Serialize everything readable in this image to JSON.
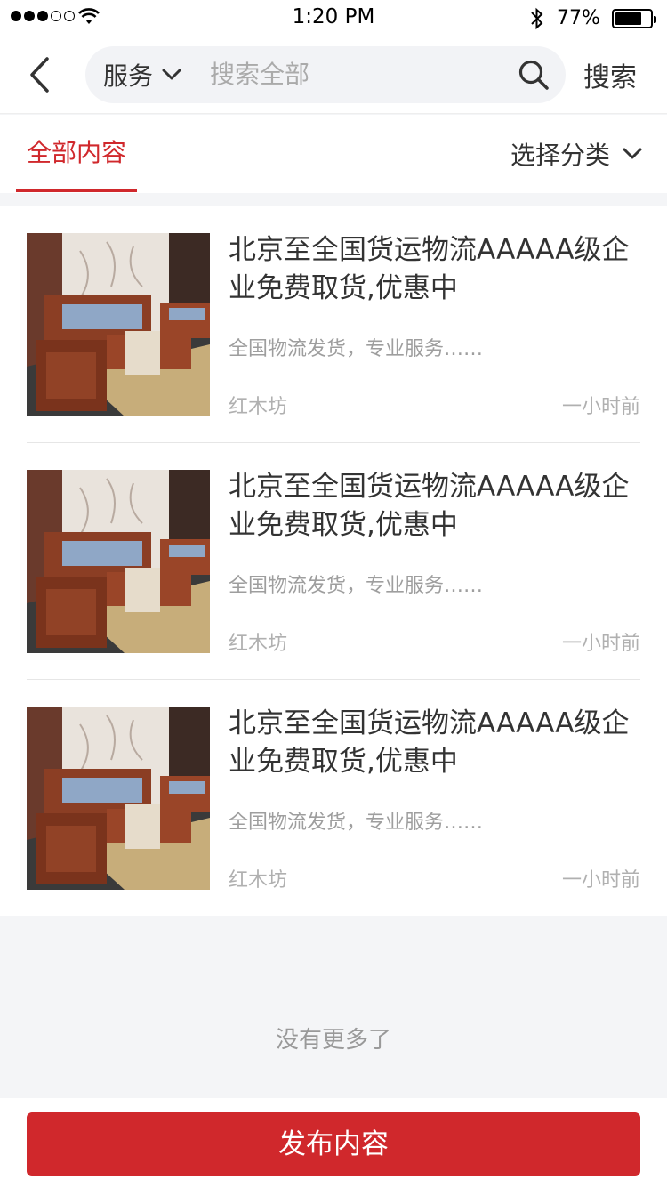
{
  "status_bar": {
    "time": "1:20 PM",
    "battery_percent": "77%",
    "battery_level": 0.77
  },
  "header": {
    "scope_label": "服务",
    "search_placeholder": "搜索全部",
    "search_button": "搜索"
  },
  "tabs": {
    "active_label": "全部内容",
    "category_label": "选择分类"
  },
  "items": [
    {
      "title": "北京至全国货运物流AAAAA级企业免费取货,优惠中",
      "description": "全国物流发货，专业服务……",
      "shop": "红木坊",
      "time": "一小时前"
    },
    {
      "title": "北京至全国货运物流AAAAA级企业免费取货,优惠中",
      "description": "全国物流发货，专业服务……",
      "shop": "红木坊",
      "time": "一小时前"
    },
    {
      "title": "北京至全国货运物流AAAAA级企业免费取货,优惠中",
      "description": "全国物流发货，专业服务……",
      "shop": "红木坊",
      "time": "一小时前"
    }
  ],
  "footer": {
    "no_more_text": "没有更多了",
    "publish_button": "发布内容"
  },
  "colors": {
    "accent": "#d0282c"
  }
}
